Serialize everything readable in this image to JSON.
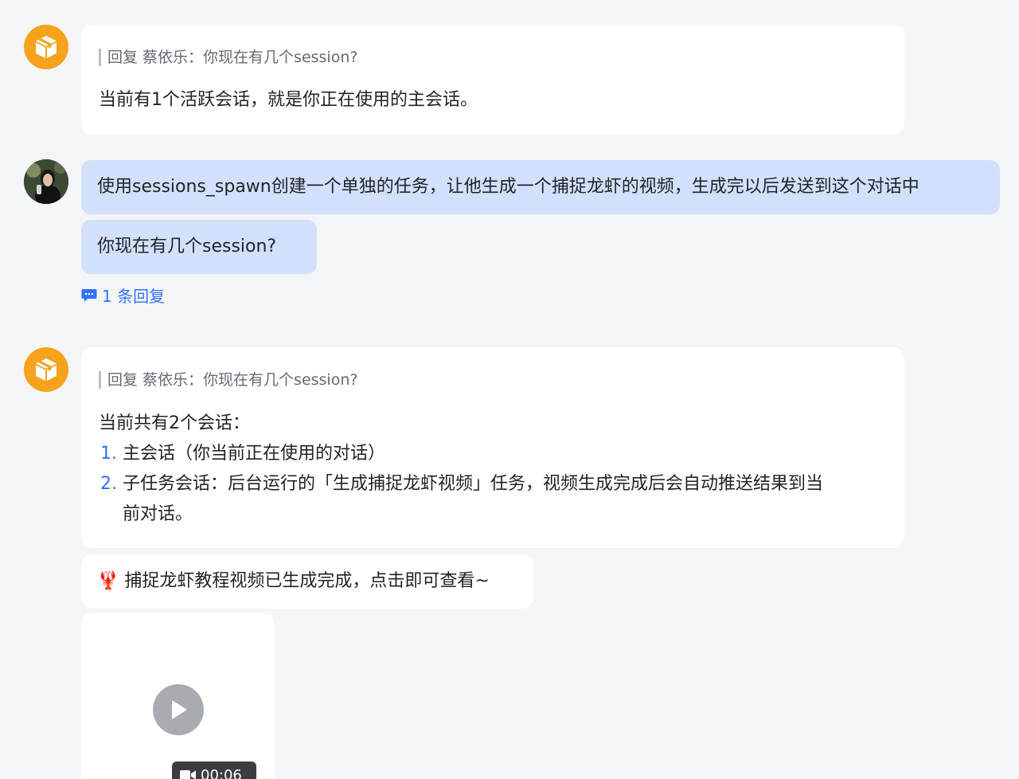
{
  "messages": {
    "bot_reply_1": {
      "quote": "回复 蔡依乐：你现在有几个session?",
      "text": "当前有1个活跃会话，就是你正在使用的主会话。"
    },
    "user_msg_1": {
      "text": "使用sessions_spawn创建一个单独的任务，让他生成一个捕捉龙虾的视频，生成完以后发送到这个对话中"
    },
    "user_msg_2": {
      "text": "你现在有几个session?"
    },
    "reply_count_link": "1 条回复",
    "bot_reply_2": {
      "quote": "回复 蔡依乐：你现在有几个session?",
      "intro": "当前共有2个会话：",
      "items": [
        {
          "num": "1.",
          "text": "主会话（你当前正在使用的对话）"
        },
        {
          "num": "2.",
          "text": "子任务会话：后台运行的「生成捕捉龙虾视频」任务，视频生成完成后会自动推送结果到当",
          "cont": "前对话。"
        }
      ]
    },
    "bot_msg_3": {
      "emoji": "🦞",
      "text": "捕捉龙虾教程视频已生成完成，点击即可查看~"
    },
    "video": {
      "duration": "00:06"
    }
  },
  "colors": {
    "bot_avatar": "#f6a21d",
    "user_bubble": "#d3e0fb",
    "link": "#3370ff",
    "background": "#f4f5f7"
  },
  "icons": {
    "bot_avatar": "cube-box-icon",
    "reply": "chat-bubble-icon",
    "play": "play-icon",
    "video_cam": "video-camera-icon"
  }
}
